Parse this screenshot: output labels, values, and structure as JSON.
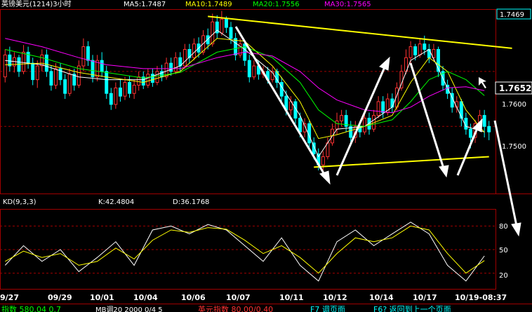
{
  "header": {
    "symbol_label": "英镑美元(1214)3小时",
    "ma5": "MA5:1.7487",
    "ma10": "MA10:1.7489",
    "ma20": "MA20:1.7556",
    "ma30": "MA30:1.7565"
  },
  "colors": {
    "up": "#ff3232",
    "down": "#00ffff",
    "ma5": "#ffffff",
    "ma10": "#ffff00",
    "ma20": "#00ff00",
    "ma30": "#ff00ff",
    "trend": "#ffff00",
    "arrow": "#ffffff",
    "frame": "#a00000",
    "grid": "#a00000"
  },
  "chart_data": {
    "type": "candlestick",
    "price_axis": {
      "ticks": [
        "1.7469",
        "1.7600",
        "1.7500"
      ],
      "current": "1.7652",
      "ylim": [
        1.7378,
        1.7712
      ]
    },
    "x_ticks": [
      "9/27",
      "09/29",
      "10/01",
      "10/04",
      "10/06",
      "10/07",
      "10/11",
      "10/12",
      "10/14",
      "10/17",
      "10/19-08:37"
    ],
    "candles": [
      [
        1.759,
        1.763,
        1.764,
        1.758
      ],
      [
        1.763,
        1.761,
        1.7645,
        1.76
      ],
      [
        1.761,
        1.7625,
        1.7635,
        1.7598
      ],
      [
        1.7625,
        1.76,
        1.763,
        1.759
      ],
      [
        1.76,
        1.7635,
        1.7648,
        1.7595
      ],
      [
        1.7635,
        1.7615,
        1.7645,
        1.7605
      ],
      [
        1.7615,
        1.7585,
        1.7625,
        1.7575
      ],
      [
        1.7585,
        1.761,
        1.762,
        1.757
      ],
      [
        1.761,
        1.763,
        1.764,
        1.76
      ],
      [
        1.763,
        1.76,
        1.764,
        1.759
      ],
      [
        1.76,
        1.7575,
        1.761,
        1.7565
      ],
      [
        1.7575,
        1.7605,
        1.7615,
        1.7568
      ],
      [
        1.7605,
        1.7585,
        1.7615,
        1.7575
      ],
      [
        1.7585,
        1.756,
        1.7595,
        1.755
      ],
      [
        1.756,
        1.7595,
        1.7605,
        1.7555
      ],
      [
        1.7595,
        1.7575,
        1.7605,
        1.7565
      ],
      [
        1.7575,
        1.761,
        1.762,
        1.757
      ],
      [
        1.761,
        1.7645,
        1.766,
        1.76
      ],
      [
        1.7645,
        1.762,
        1.7655,
        1.761
      ],
      [
        1.762,
        1.759,
        1.763,
        1.758
      ],
      [
        1.759,
        1.762,
        1.763,
        1.7582
      ],
      [
        1.762,
        1.76,
        1.7635,
        1.759
      ],
      [
        1.76,
        1.756,
        1.761,
        1.755
      ],
      [
        1.756,
        1.754,
        1.757,
        1.753
      ],
      [
        1.754,
        1.757,
        1.758,
        1.7532
      ],
      [
        1.757,
        1.7555,
        1.7585,
        1.7545
      ],
      [
        1.7555,
        1.758,
        1.759,
        1.7548
      ],
      [
        1.758,
        1.756,
        1.7592,
        1.7552
      ],
      [
        1.756,
        1.7575,
        1.7585,
        1.755
      ],
      [
        1.7575,
        1.759,
        1.76,
        1.7565
      ],
      [
        1.759,
        1.7575,
        1.76,
        1.7568
      ],
      [
        1.7575,
        1.7595,
        1.7605,
        1.757
      ],
      [
        1.7595,
        1.758,
        1.7605,
        1.7572
      ],
      [
        1.758,
        1.76,
        1.761,
        1.7575
      ],
      [
        1.76,
        1.759,
        1.7612,
        1.7582
      ],
      [
        1.759,
        1.7615,
        1.7625,
        1.7585
      ],
      [
        1.7615,
        1.76,
        1.7625,
        1.7592
      ],
      [
        1.76,
        1.7625,
        1.7635,
        1.7595
      ],
      [
        1.7625,
        1.761,
        1.7635,
        1.76
      ],
      [
        1.761,
        1.764,
        1.765,
        1.7605
      ],
      [
        1.764,
        1.7625,
        1.765,
        1.7615
      ],
      [
        1.7625,
        1.765,
        1.766,
        1.762
      ],
      [
        1.765,
        1.7635,
        1.7662,
        1.7625
      ],
      [
        1.7635,
        1.7665,
        1.7675,
        1.763
      ],
      [
        1.7665,
        1.765,
        1.7678,
        1.764
      ],
      [
        1.765,
        1.769,
        1.7705,
        1.7645
      ],
      [
        1.769,
        1.767,
        1.7702,
        1.766
      ],
      [
        1.767,
        1.7695,
        1.771,
        1.7665
      ],
      [
        1.7695,
        1.768,
        1.77,
        1.767
      ],
      [
        1.768,
        1.766,
        1.769,
        1.765
      ],
      [
        1.766,
        1.763,
        1.767,
        1.762
      ],
      [
        1.763,
        1.765,
        1.766,
        1.7625
      ],
      [
        1.765,
        1.762,
        1.7655,
        1.761
      ],
      [
        1.762,
        1.759,
        1.763,
        1.758
      ],
      [
        1.759,
        1.761,
        1.762,
        1.7585
      ],
      [
        1.761,
        1.7595,
        1.762,
        1.7585
      ],
      [
        1.7595,
        1.76,
        1.761,
        1.7588
      ],
      [
        1.76,
        1.7585,
        1.7608,
        1.7578
      ],
      [
        1.7585,
        1.76,
        1.7608,
        1.758
      ],
      [
        1.76,
        1.758,
        1.7605,
        1.757
      ],
      [
        1.758,
        1.7555,
        1.759,
        1.7545
      ],
      [
        1.7555,
        1.753,
        1.7565,
        1.752
      ],
      [
        1.753,
        1.7545,
        1.7555,
        1.752
      ],
      [
        1.7545,
        1.7515,
        1.755,
        1.7505
      ],
      [
        1.7515,
        1.749,
        1.7525,
        1.748
      ],
      [
        1.749,
        1.7505,
        1.7515,
        1.748
      ],
      [
        1.7505,
        1.747,
        1.751,
        1.746
      ],
      [
        1.747,
        1.745,
        1.748,
        1.744
      ],
      [
        1.745,
        1.743,
        1.746,
        1.742
      ],
      [
        1.743,
        1.7445,
        1.7455,
        1.742
      ],
      [
        1.7445,
        1.747,
        1.748,
        1.744
      ],
      [
        1.747,
        1.7495,
        1.7505,
        1.7465
      ],
      [
        1.7495,
        1.751,
        1.7525,
        1.7485
      ],
      [
        1.751,
        1.752,
        1.753,
        1.75
      ],
      [
        1.752,
        1.75,
        1.753,
        1.749
      ],
      [
        1.75,
        1.748,
        1.751,
        1.747
      ],
      [
        1.748,
        1.75,
        1.751,
        1.747
      ],
      [
        1.75,
        1.749,
        1.751,
        1.748
      ],
      [
        1.749,
        1.7515,
        1.7525,
        1.7485
      ],
      [
        1.7515,
        1.7495,
        1.7525,
        1.7485
      ],
      [
        1.7495,
        1.752,
        1.753,
        1.749
      ],
      [
        1.752,
        1.7545,
        1.7555,
        1.7515
      ],
      [
        1.7545,
        1.7525,
        1.7555,
        1.7515
      ],
      [
        1.7525,
        1.755,
        1.756,
        1.752
      ],
      [
        1.755,
        1.7535,
        1.756,
        1.7525
      ],
      [
        1.7535,
        1.757,
        1.758,
        1.753
      ],
      [
        1.757,
        1.76,
        1.7612,
        1.7565
      ],
      [
        1.76,
        1.7625,
        1.764,
        1.7595
      ],
      [
        1.7625,
        1.7645,
        1.7655,
        1.7615
      ],
      [
        1.7645,
        1.763,
        1.765,
        1.762
      ],
      [
        1.763,
        1.765,
        1.766,
        1.7625
      ],
      [
        1.765,
        1.764,
        1.7665,
        1.763
      ],
      [
        1.764,
        1.7625,
        1.765,
        1.7615
      ],
      [
        1.7625,
        1.764,
        1.765,
        1.762
      ],
      [
        1.764,
        1.76,
        1.7645,
        1.759
      ],
      [
        1.76,
        1.7575,
        1.761,
        1.7565
      ],
      [
        1.7575,
        1.756,
        1.7585,
        1.755
      ],
      [
        1.756,
        1.7535,
        1.757,
        1.7525
      ],
      [
        1.7535,
        1.7545,
        1.7555,
        1.7525
      ],
      [
        1.7545,
        1.7515,
        1.755,
        1.75
      ],
      [
        1.7515,
        1.7495,
        1.7525,
        1.7485
      ],
      [
        1.7495,
        1.748,
        1.7505,
        1.746
      ],
      [
        1.748,
        1.7505,
        1.7512,
        1.747
      ],
      [
        1.7505,
        1.752,
        1.753,
        1.7495
      ],
      [
        1.752,
        1.75,
        1.753,
        1.748
      ],
      [
        1.75,
        1.749,
        1.751,
        1.7475
      ]
    ],
    "ma": {
      "ma5": [
        [
          0,
          1.762
        ],
        [
          8,
          1.7612
        ],
        [
          16,
          1.759
        ],
        [
          22,
          1.7585
        ],
        [
          30,
          1.7585
        ],
        [
          38,
          1.761
        ],
        [
          46,
          1.7675
        ],
        [
          52,
          1.764
        ],
        [
          58,
          1.7598
        ],
        [
          64,
          1.752
        ],
        [
          68,
          1.7445
        ],
        [
          72,
          1.7495
        ],
        [
          78,
          1.75
        ],
        [
          84,
          1.7535
        ],
        [
          88,
          1.762
        ],
        [
          92,
          1.764
        ],
        [
          96,
          1.757
        ],
        [
          100,
          1.75
        ],
        [
          104,
          1.749
        ]
      ],
      "ma10": [
        [
          0,
          1.7612
        ],
        [
          8,
          1.7615
        ],
        [
          16,
          1.7598
        ],
        [
          22,
          1.759
        ],
        [
          30,
          1.758
        ],
        [
          38,
          1.76
        ],
        [
          46,
          1.766
        ],
        [
          52,
          1.7655
        ],
        [
          58,
          1.761
        ],
        [
          64,
          1.7545
        ],
        [
          68,
          1.7478
        ],
        [
          72,
          1.7485
        ],
        [
          78,
          1.75
        ],
        [
          84,
          1.752
        ],
        [
          88,
          1.758
        ],
        [
          92,
          1.7625
        ],
        [
          96,
          1.76
        ],
        [
          100,
          1.753
        ],
        [
          104,
          1.7489
        ]
      ],
      "ma20": [
        [
          0,
          1.764
        ],
        [
          8,
          1.7625
        ],
        [
          16,
          1.7605
        ],
        [
          22,
          1.7598
        ],
        [
          30,
          1.7588
        ],
        [
          38,
          1.7598
        ],
        [
          46,
          1.7635
        ],
        [
          52,
          1.7645
        ],
        [
          58,
          1.7625
        ],
        [
          64,
          1.758
        ],
        [
          68,
          1.753
        ],
        [
          72,
          1.7505
        ],
        [
          78,
          1.75
        ],
        [
          84,
          1.7512
        ],
        [
          88,
          1.7545
        ],
        [
          92,
          1.7585
        ],
        [
          96,
          1.76
        ],
        [
          100,
          1.7585
        ],
        [
          104,
          1.7556
        ]
      ],
      "ma30": [
        [
          0,
          1.766
        ],
        [
          8,
          1.7645
        ],
        [
          16,
          1.7625
        ],
        [
          22,
          1.7612
        ],
        [
          30,
          1.7605
        ],
        [
          38,
          1.7605
        ],
        [
          46,
          1.7625
        ],
        [
          52,
          1.7635
        ],
        [
          58,
          1.7628
        ],
        [
          64,
          1.76
        ],
        [
          68,
          1.757
        ],
        [
          72,
          1.7548
        ],
        [
          78,
          1.753
        ],
        [
          84,
          1.7525
        ],
        [
          88,
          1.7535
        ],
        [
          92,
          1.7555
        ],
        [
          96,
          1.757
        ],
        [
          100,
          1.7572
        ],
        [
          104,
          1.7565
        ]
      ]
    },
    "trendlines": [
      {
        "from": [
          44,
          1.77
        ],
        "to": [
          110,
          1.7642
        ]
      },
      {
        "from": [
          67,
          1.7426
        ],
        "to": [
          105,
          1.7445
        ]
      }
    ],
    "kd": {
      "label": "KD(9,3,3)",
      "k_text": "K:42.4804",
      "d_text": "D:36.1768",
      "ticks": [
        "80",
        "50",
        "20"
      ],
      "k": [
        [
          0,
          30
        ],
        [
          4,
          55
        ],
        [
          8,
          35
        ],
        [
          12,
          50
        ],
        [
          16,
          22
        ],
        [
          20,
          40
        ],
        [
          24,
          60
        ],
        [
          28,
          30
        ],
        [
          32,
          75
        ],
        [
          36,
          80
        ],
        [
          40,
          70
        ],
        [
          44,
          82
        ],
        [
          48,
          75
        ],
        [
          52,
          55
        ],
        [
          56,
          35
        ],
        [
          60,
          65
        ],
        [
          64,
          30
        ],
        [
          68,
          10
        ],
        [
          72,
          60
        ],
        [
          76,
          75
        ],
        [
          80,
          55
        ],
        [
          84,
          70
        ],
        [
          88,
          85
        ],
        [
          92,
          70
        ],
        [
          96,
          30
        ],
        [
          100,
          10
        ],
        [
          104,
          42
        ]
      ],
      "d": [
        [
          0,
          35
        ],
        [
          4,
          48
        ],
        [
          8,
          40
        ],
        [
          12,
          45
        ],
        [
          16,
          30
        ],
        [
          20,
          35
        ],
        [
          24,
          52
        ],
        [
          28,
          38
        ],
        [
          32,
          62
        ],
        [
          36,
          75
        ],
        [
          40,
          72
        ],
        [
          44,
          78
        ],
        [
          48,
          76
        ],
        [
          52,
          62
        ],
        [
          56,
          45
        ],
        [
          60,
          55
        ],
        [
          64,
          40
        ],
        [
          68,
          20
        ],
        [
          72,
          45
        ],
        [
          76,
          65
        ],
        [
          80,
          60
        ],
        [
          84,
          65
        ],
        [
          88,
          80
        ],
        [
          92,
          75
        ],
        [
          96,
          45
        ],
        [
          100,
          20
        ],
        [
          104,
          36
        ]
      ]
    }
  },
  "footer": {
    "text1": "指数 580.04 0.7",
    "text2": "MB调20 2000 0/4 5",
    "text3": "英元指数 80.00/0.40",
    "text4": "F7 调页面",
    "text5": "F6? 返回到上一个页面"
  }
}
